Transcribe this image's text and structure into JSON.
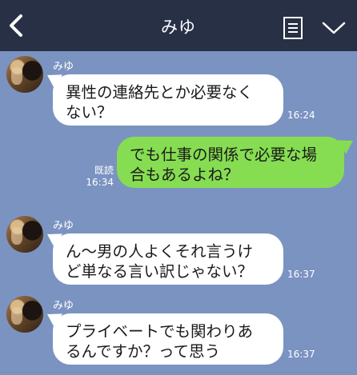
{
  "header": {
    "title": "みゆ",
    "back_icon": "chevron-left-icon",
    "menu_icon": "notes-icon",
    "collapse_icon": "chevron-down-icon",
    "background": "#283046"
  },
  "chat_background": "#7b93c1",
  "bubble_colors": {
    "incoming": "#ffffff",
    "outgoing": "#86dd52"
  },
  "messages": [
    {
      "sender": "みゆ",
      "direction": "in",
      "text": "異性の連絡先とか必要なく\nない？",
      "time": "16:24"
    },
    {
      "direction": "out",
      "text": "でも仕事の関係で必要な場\n合もあるよね？",
      "read": "既読",
      "time": "16:34"
    },
    {
      "sender": "みゆ",
      "direction": "in",
      "text": "ん〜男の人よくそれ言うけ\nど単なる言い訳じゃない？",
      "time": "16:37"
    },
    {
      "sender": "みゆ",
      "direction": "in",
      "text": "プライベートでも関わりあ\nるんですか？って思う",
      "time": "16:37"
    }
  ]
}
